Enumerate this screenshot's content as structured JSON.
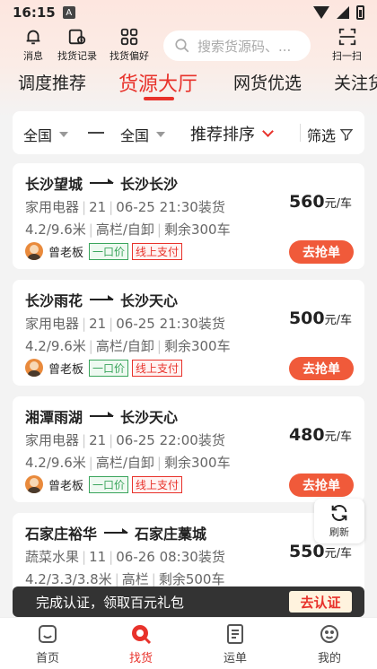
{
  "status": {
    "time": "16:15",
    "a_badge": "A"
  },
  "quick_actions": [
    {
      "label": "消息",
      "icon": "bell-icon"
    },
    {
      "label": "找货记录",
      "icon": "history-icon"
    },
    {
      "label": "找货偏好",
      "icon": "preference-grid-icon"
    }
  ],
  "search": {
    "placeholder": "搜索货源码、..."
  },
  "scan": {
    "label": "扫一扫"
  },
  "tabs": [
    {
      "label": "调度推荐",
      "active": false
    },
    {
      "label": "货源大厅",
      "active": true
    },
    {
      "label": "网货优选",
      "active": false
    },
    {
      "label": "关注货",
      "active": false
    }
  ],
  "filter": {
    "from": "全国",
    "to": "全国",
    "sort": "推荐排序",
    "filter_label": "筛选"
  },
  "cards": [
    {
      "from": "长沙望城",
      "to": "长沙长沙",
      "goods": "家用电器",
      "qty": "21",
      "load_time": "06-25 21:30装货",
      "size": "4.2/9.6米",
      "truck": "高栏/自卸",
      "remaining": "剩余300车",
      "price": "560",
      "unit": "元/车",
      "owner": "曾老板",
      "tag1": "一口价",
      "tag2": "线上支付",
      "button": "去抢单"
    },
    {
      "from": "长沙雨花",
      "to": "长沙天心",
      "goods": "家用电器",
      "qty": "21",
      "load_time": "06-25 21:30装货",
      "size": "4.2/9.6米",
      "truck": "高栏/自卸",
      "remaining": "剩余300车",
      "price": "500",
      "unit": "元/车",
      "owner": "曾老板",
      "tag1": "一口价",
      "tag2": "线上支付",
      "button": "去抢单"
    },
    {
      "from": "湘潭雨湖",
      "to": "长沙天心",
      "goods": "家用电器",
      "qty": "21",
      "load_time": "06-25 22:00装货",
      "size": "4.2/9.6米",
      "truck": "高栏/自卸",
      "remaining": "剩余300车",
      "price": "480",
      "unit": "元/车",
      "owner": "曾老板",
      "tag1": "一口价",
      "tag2": "线上支付",
      "button": "去抢单"
    },
    {
      "from": "石家庄裕华",
      "to": "石家庄藁城",
      "goods": "蔬菜水果",
      "qty": "11",
      "load_time": "06-26 08:30装货",
      "size": "4.2/3.3/3.8米",
      "truck": "高栏",
      "remaining": "剩余500车",
      "price": "550",
      "unit": "元/车"
    }
  ],
  "refresh": {
    "label": "刷新"
  },
  "banner": {
    "text": "完成认证，领取百元礼包",
    "button": "去认证"
  },
  "nav": [
    {
      "label": "首页",
      "icon": "home-icon"
    },
    {
      "label": "找货",
      "icon": "find-goods-icon"
    },
    {
      "label": "运单",
      "icon": "waybill-icon"
    },
    {
      "label": "我的",
      "icon": "profile-icon"
    }
  ],
  "colors": {
    "accent": "#e8322b",
    "button": "#f05a3a",
    "green_tag": "#3aa55c"
  }
}
